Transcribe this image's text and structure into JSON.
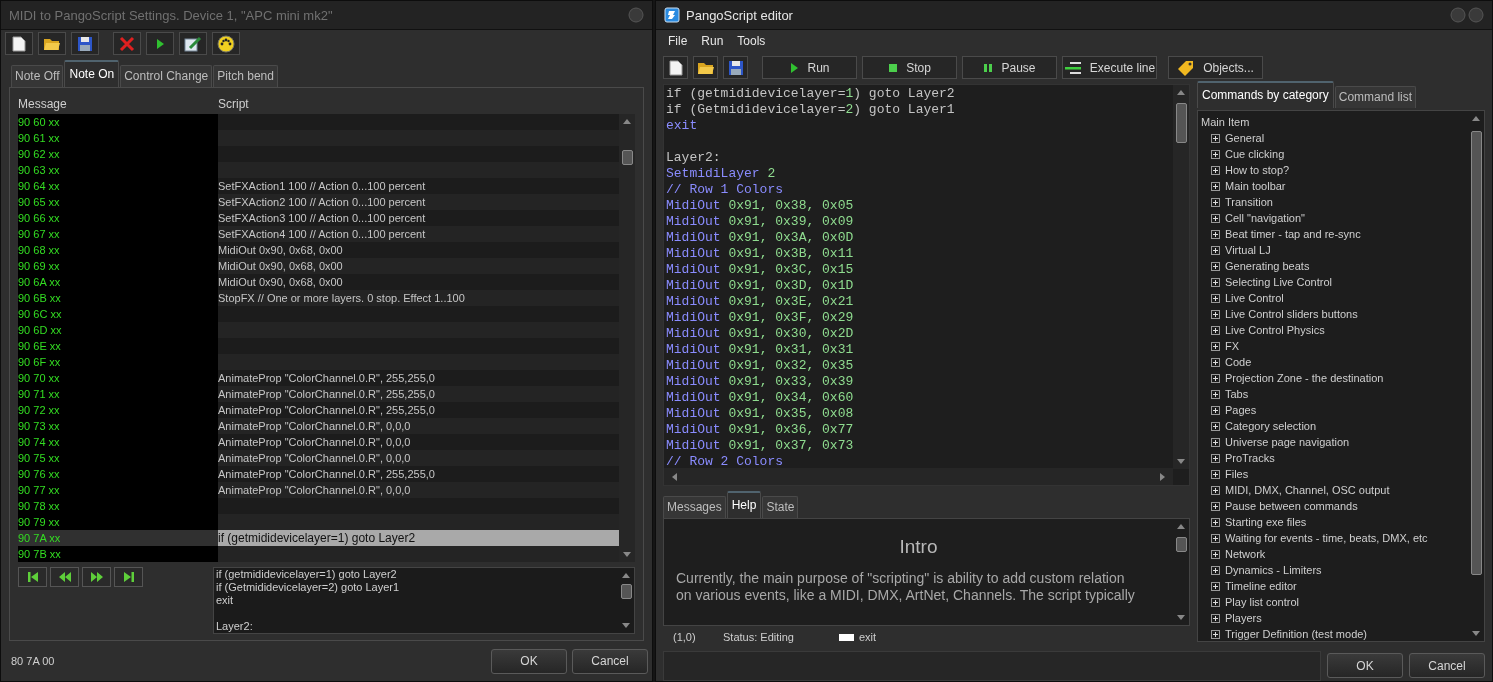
{
  "midi_window": {
    "title": "MIDI to PangoScript Settings. Device 1, \"APC mini mk2\"",
    "tabs": [
      {
        "label": "Note Off",
        "selected": false
      },
      {
        "label": "Note On",
        "selected": true
      },
      {
        "label": "Control Change",
        "selected": false
      },
      {
        "label": "Pitch bend",
        "selected": false
      }
    ],
    "columns": [
      "Message",
      "Script"
    ],
    "rows": [
      {
        "message": "90 60 xx",
        "script": "",
        "selected": false
      },
      {
        "message": "90 61 xx",
        "script": "",
        "selected": false
      },
      {
        "message": "90 62 xx",
        "script": "",
        "selected": false
      },
      {
        "message": "90 63 xx",
        "script": "",
        "selected": false
      },
      {
        "message": "90 64 xx",
        "script": "SetFXAction1 100 // Action 0...100 percent",
        "selected": false
      },
      {
        "message": "90 65 xx",
        "script": "SetFXAction2 100 // Action 0...100 percent",
        "selected": false
      },
      {
        "message": "90 66 xx",
        "script": "SetFXAction3 100 // Action 0...100 percent",
        "selected": false
      },
      {
        "message": "90 67 xx",
        "script": "SetFXAction4 100 // Action 0...100 percent",
        "selected": false
      },
      {
        "message": "90 68 xx",
        "script": "MidiOut 0x90, 0x68, 0x00",
        "selected": false
      },
      {
        "message": "90 69 xx",
        "script": "MidiOut 0x90, 0x68, 0x00",
        "selected": false
      },
      {
        "message": "90 6A xx",
        "script": "MidiOut 0x90, 0x68, 0x00",
        "selected": false
      },
      {
        "message": "90 6B xx",
        "script": "StopFX // One or more layers. 0 stop. Effect 1..100",
        "selected": false
      },
      {
        "message": "90 6C xx",
        "script": "",
        "selected": false
      },
      {
        "message": "90 6D xx",
        "script": "",
        "selected": false
      },
      {
        "message": "90 6E xx",
        "script": "",
        "selected": false
      },
      {
        "message": "90 6F xx",
        "script": "",
        "selected": false
      },
      {
        "message": "90 70 xx",
        "script": "AnimateProp \"ColorChannel.0.R\", 255,255,0",
        "selected": false
      },
      {
        "message": "90 71 xx",
        "script": "AnimateProp \"ColorChannel.0.R\", 255,255,0",
        "selected": false
      },
      {
        "message": "90 72 xx",
        "script": "AnimateProp \"ColorChannel.0.R\", 255,255,0",
        "selected": false
      },
      {
        "message": "90 73 xx",
        "script": "AnimateProp \"ColorChannel.0.R\", 0,0,0",
        "selected": false
      },
      {
        "message": "90 74 xx",
        "script": "AnimateProp \"ColorChannel.0.R\", 0,0,0",
        "selected": false
      },
      {
        "message": "90 75 xx",
        "script": "AnimateProp \"ColorChannel.0.R\", 0,0,0",
        "selected": false
      },
      {
        "message": "90 76 xx",
        "script": "AnimateProp \"ColorChannel.0.R\", 255,255,0",
        "selected": false
      },
      {
        "message": "90 77 xx",
        "script": "AnimateProp \"ColorChannel.0.R\", 0,0,0",
        "selected": false
      },
      {
        "message": "90 78 xx",
        "selected": false
      },
      {
        "message": "90 79 xx",
        "selected": false
      },
      {
        "message": "90 7A xx",
        "script": "if (getmididevicelayer=1) goto Layer2",
        "selected": true
      },
      {
        "message": "90 7B xx",
        "selected": false
      }
    ],
    "preview_lines": [
      {
        "kind": "text",
        "text": "if (getmididevicelayer=1) goto Layer2"
      },
      {
        "kind": "text",
        "text": "if (Getmididevicelayer=2) goto Layer1"
      },
      {
        "kind": "text",
        "text": "exit"
      },
      {
        "kind": "blank"
      },
      {
        "kind": "text",
        "text": "Layer2:"
      }
    ],
    "status": "80 7A 00",
    "buttons": [
      "OK",
      "Cancel"
    ]
  },
  "editor_window": {
    "title": "PangoScript editor",
    "menu": [
      "File",
      "Run",
      "Tools"
    ],
    "toolbar_buttons": [
      "Run",
      "Stop",
      "Pause",
      "Execute line",
      "Objects..."
    ],
    "code_lines": [
      {
        "kind": "code",
        "tokens": [
          {
            "text": "if (getmididevicelayer=",
            "kind": "plain"
          },
          {
            "text": "1",
            "kind": "number"
          },
          {
            "text": ") goto Layer2",
            "kind": "plain"
          }
        ]
      },
      {
        "kind": "code",
        "tokens": [
          {
            "text": "if (Getmididevicelayer=",
            "kind": "plain"
          },
          {
            "text": "2",
            "kind": "number"
          },
          {
            "text": ") goto Layer1",
            "kind": "plain"
          }
        ]
      },
      {
        "kind": "code",
        "tokens": [
          {
            "text": "exit",
            "kind": "command"
          }
        ]
      },
      {
        "kind": "blank"
      },
      {
        "kind": "code",
        "tokens": [
          {
            "text": "Layer2:",
            "kind": "plain"
          }
        ]
      },
      {
        "kind": "code",
        "tokens": [
          {
            "text": "SetmidiLayer ",
            "kind": "command"
          },
          {
            "text": "2",
            "kind": "number"
          }
        ]
      },
      {
        "kind": "code",
        "tokens": [
          {
            "text": "// Row 1 Colors",
            "kind": "comment"
          }
        ]
      },
      {
        "kind": "code",
        "tokens": [
          {
            "text": "MidiOut ",
            "kind": "command"
          },
          {
            "text": "0x91, 0x38, 0x05",
            "kind": "number"
          }
        ]
      },
      {
        "kind": "code",
        "tokens": [
          {
            "text": "MidiOut ",
            "kind": "command"
          },
          {
            "text": "0x91, 0x39, 0x09",
            "kind": "number"
          }
        ]
      },
      {
        "kind": "code",
        "tokens": [
          {
            "text": "MidiOut ",
            "kind": "command"
          },
          {
            "text": "0x91, 0x3A, 0x0D",
            "kind": "number"
          }
        ]
      },
      {
        "kind": "code",
        "tokens": [
          {
            "text": "MidiOut ",
            "kind": "command"
          },
          {
            "text": "0x91, 0x3B, 0x11",
            "kind": "number"
          }
        ]
      },
      {
        "kind": "code",
        "tokens": [
          {
            "text": "MidiOut ",
            "kind": "command"
          },
          {
            "text": "0x91, 0x3C, 0x15",
            "kind": "number"
          }
        ]
      },
      {
        "kind": "code",
        "tokens": [
          {
            "text": "MidiOut ",
            "kind": "command"
          },
          {
            "text": "0x91, 0x3D, 0x1D",
            "kind": "number"
          }
        ]
      },
      {
        "kind": "code",
        "tokens": [
          {
            "text": "MidiOut ",
            "kind": "command"
          },
          {
            "text": "0x91, 0x3E, 0x21",
            "kind": "number"
          }
        ]
      },
      {
        "kind": "code",
        "tokens": [
          {
            "text": "MidiOut ",
            "kind": "command"
          },
          {
            "text": "0x91, 0x3F, 0x29",
            "kind": "number"
          }
        ]
      },
      {
        "kind": "code",
        "tokens": [
          {
            "text": "MidiOut ",
            "kind": "command"
          },
          {
            "text": "0x91, 0x30, 0x2D",
            "kind": "number"
          }
        ]
      },
      {
        "kind": "code",
        "tokens": [
          {
            "text": "MidiOut ",
            "kind": "command"
          },
          {
            "text": "0x91, 0x31, 0x31",
            "kind": "number"
          }
        ]
      },
      {
        "kind": "code",
        "tokens": [
          {
            "text": "MidiOut ",
            "kind": "command"
          },
          {
            "text": "0x91, 0x32, 0x35",
            "kind": "number"
          }
        ]
      },
      {
        "kind": "code",
        "tokens": [
          {
            "text": "MidiOut ",
            "kind": "command"
          },
          {
            "text": "0x91, 0x33, 0x39",
            "kind": "number"
          }
        ]
      },
      {
        "kind": "code",
        "tokens": [
          {
            "text": "MidiOut ",
            "kind": "command"
          },
          {
            "text": "0x91, 0x34, 0x60",
            "kind": "number"
          }
        ]
      },
      {
        "kind": "code",
        "tokens": [
          {
            "text": "MidiOut ",
            "kind": "command"
          },
          {
            "text": "0x91, 0x35, 0x08",
            "kind": "number"
          }
        ]
      },
      {
        "kind": "code",
        "tokens": [
          {
            "text": "MidiOut ",
            "kind": "command"
          },
          {
            "text": "0x91, 0x36, 0x77",
            "kind": "number"
          }
        ]
      },
      {
        "kind": "code",
        "tokens": [
          {
            "text": "MidiOut ",
            "kind": "command"
          },
          {
            "text": "0x91, 0x37, 0x73",
            "kind": "number"
          }
        ]
      },
      {
        "kind": "code",
        "tokens": [
          {
            "text": "// Row 2 Colors",
            "kind": "comment"
          }
        ]
      }
    ],
    "bottom_tabs": [
      {
        "label": "Messages",
        "selected": false
      },
      {
        "label": "Help",
        "selected": true
      },
      {
        "label": "State",
        "selected": false
      }
    ],
    "help": {
      "heading": "Intro",
      "lines": [
        "Currently, the main purpose of \"scripting\" is ability to add custom relation",
        "on various events, like a MIDI, DMX, ArtNet, Channels. The script typically"
      ]
    },
    "status": {
      "position": "(1,0)",
      "state": "Status: Editing",
      "current": "exit"
    },
    "side_tabs": [
      {
        "label": "Commands by category",
        "selected": true
      },
      {
        "label": "Command list",
        "selected": false
      }
    ],
    "tree": {
      "root": "Main Item",
      "children": [
        {
          "label": "General",
          "expanded": false
        },
        {
          "label": "Cue clicking",
          "expanded": false
        },
        {
          "label": "How to stop?",
          "expanded": false
        },
        {
          "label": "Main toolbar",
          "expanded": false
        },
        {
          "label": "Transition",
          "expanded": false
        },
        {
          "label": "Cell \"navigation\"",
          "expanded": false
        },
        {
          "label": "Beat timer - tap and re-sync",
          "expanded": false
        },
        {
          "label": "Virtual LJ",
          "expanded": false
        },
        {
          "label": "Generating beats",
          "expanded": false
        },
        {
          "label": "Selecting Live Control",
          "expanded": false
        },
        {
          "label": "Live Control",
          "expanded": false
        },
        {
          "label": "Live Control sliders buttons",
          "expanded": false
        },
        {
          "label": "Live Control Physics",
          "expanded": false
        },
        {
          "label": "FX",
          "expanded": false
        },
        {
          "label": "Code",
          "expanded": false
        },
        {
          "label": "Projection Zone - the destination",
          "expanded": false
        },
        {
          "label": "Tabs",
          "expanded": false
        },
        {
          "label": "Pages",
          "expanded": false
        },
        {
          "label": "Category selection",
          "expanded": false
        },
        {
          "label": "Universe page navigation",
          "expanded": false
        },
        {
          "label": "ProTracks",
          "expanded": false
        },
        {
          "label": "Files",
          "expanded": false
        },
        {
          "label": "MIDI, DMX, Channel, OSC output",
          "expanded": false
        },
        {
          "label": "Pause between commands",
          "expanded": false
        },
        {
          "label": "Starting exe files",
          "expanded": false
        },
        {
          "label": "Waiting for events - time, beats, DMX, etc",
          "expanded": false
        },
        {
          "label": "Network",
          "expanded": false
        },
        {
          "label": "Dynamics - Limiters",
          "expanded": false
        },
        {
          "label": "Timeline editor",
          "expanded": false
        },
        {
          "label": "Play list control",
          "expanded": false
        },
        {
          "label": "Players",
          "expanded": false
        },
        {
          "label": "Trigger Definition (test mode)",
          "expanded": false
        }
      ]
    },
    "buttons": [
      "OK",
      "Cancel"
    ]
  }
}
